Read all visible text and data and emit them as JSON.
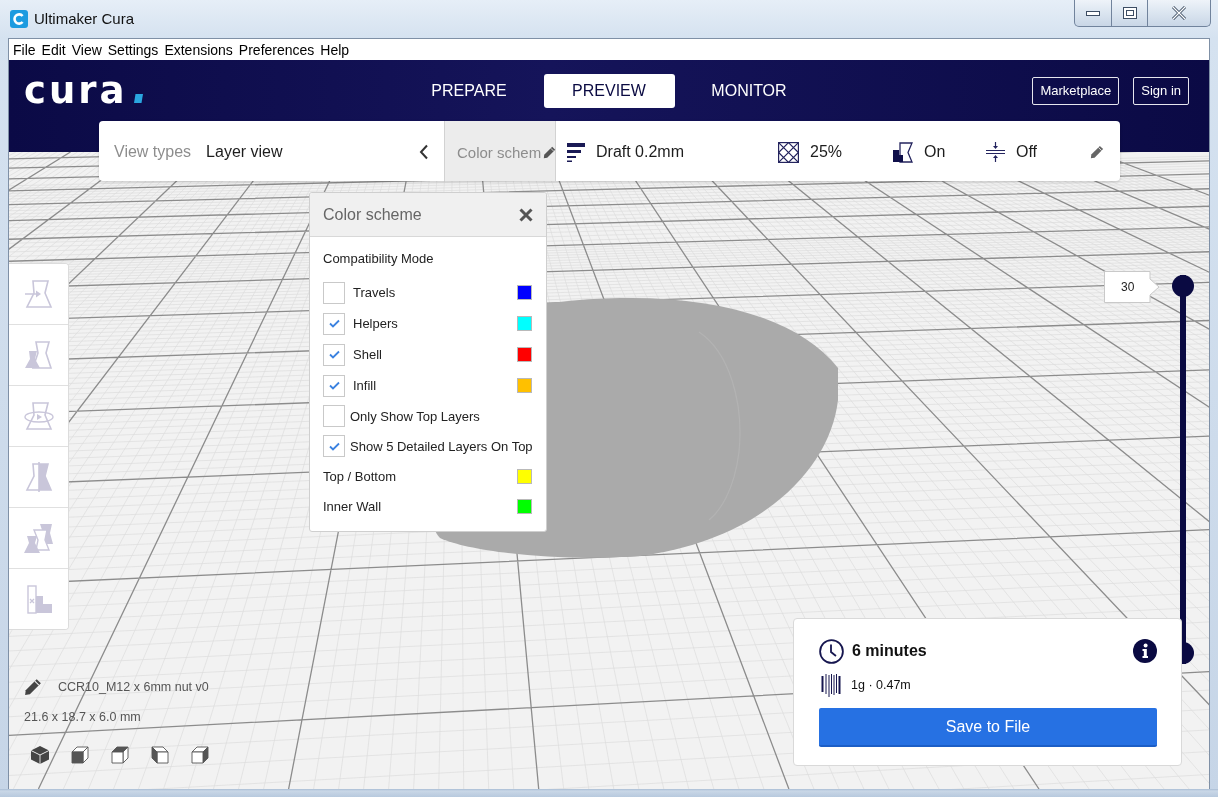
{
  "window": {
    "title": "Ultimaker Cura"
  },
  "menu_bar": [
    "File",
    "Edit",
    "View",
    "Settings",
    "Extensions",
    "Preferences",
    "Help"
  ],
  "header": {
    "logo": "cura",
    "stages": [
      {
        "label": "PREPARE",
        "selected": false
      },
      {
        "label": "PREVIEW",
        "selected": true
      },
      {
        "label": "MONITOR",
        "selected": false
      }
    ],
    "buttons": [
      "Marketplace",
      "Sign in"
    ]
  },
  "stage_menu": {
    "view_types": {
      "label": "View types",
      "value": "Layer view"
    },
    "color_scheme": {
      "label": "Color schem",
      "expanded": true
    },
    "print_setup": {
      "profile": "Draft 0.2mm",
      "settings": [
        {
          "kind": "infill",
          "value": "25%"
        },
        {
          "kind": "support",
          "value": "On"
        },
        {
          "kind": "adhesion",
          "value": "Off"
        }
      ]
    }
  },
  "color_scheme_panel": {
    "title": "Color scheme",
    "mode": "Compatibility Mode",
    "items": [
      {
        "kind": "layer",
        "label": "Travels",
        "checked": false,
        "color": "#0000ff"
      },
      {
        "kind": "layer",
        "label": "Helpers",
        "checked": true,
        "color": "#00ffff"
      },
      {
        "kind": "layer",
        "label": "Shell",
        "checked": true,
        "color": "#ff0000"
      },
      {
        "kind": "layer",
        "label": "Infill",
        "checked": true,
        "color": "#ffc000"
      },
      {
        "kind": "option",
        "label": "Only Show Top Layers",
        "checked": false
      },
      {
        "kind": "option",
        "label": "Show 5 Detailed Layers On Top",
        "checked": true
      },
      {
        "kind": "legend",
        "label": "Top / Bottom",
        "color": "#ffff00"
      },
      {
        "kind": "legend",
        "label": "Inner Wall",
        "color": "#00ff00"
      }
    ]
  },
  "layer_slider": {
    "value": "30",
    "level": 1
  },
  "object_info": {
    "name": "CCR10_M12 x 6mm nut v0",
    "dimensions": "21.6 x 18.7 x 6.0 mm"
  },
  "print_info": {
    "time": "6 minutes",
    "material": "1g · 0.47m",
    "button": "Save to File"
  }
}
